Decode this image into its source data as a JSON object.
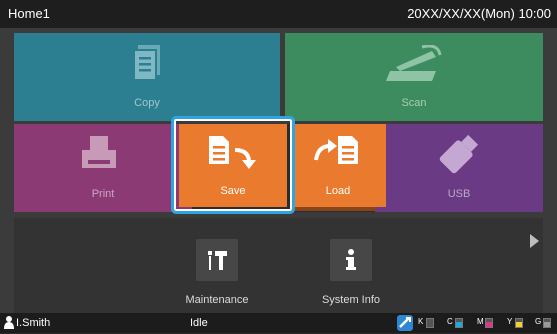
{
  "topbar": {
    "title": "Home1",
    "clock": "20XX/XX/XX(Mon) 10:00"
  },
  "tiles": {
    "copy": "Copy",
    "scan": "Scan",
    "print": "Print",
    "save": "Save",
    "load": "Load",
    "usb": "USB"
  },
  "bottom": {
    "maintenance": "Maintenance",
    "system_info": "System Info"
  },
  "status": {
    "user": "I.Smith",
    "state": "Idle",
    "inks": [
      {
        "label": "K",
        "color": "#222222",
        "level": 0.0
      },
      {
        "label": "C",
        "color": "#1fa7e0",
        "level": 0.6
      },
      {
        "label": "M",
        "color": "#e0338c",
        "level": 0.6
      },
      {
        "label": "Y",
        "color": "#f2d22b",
        "level": 0.6
      },
      {
        "label": "G",
        "color": "#9a9a9a",
        "level": 0.6
      }
    ]
  },
  "colors": {
    "copy_tile": "#2b7f90",
    "scan_tile": "#3d8c5f",
    "print_tile": "#8b3a73",
    "usb_tile": "#6a3a84",
    "save_load_tile": "#ea7a2e",
    "focus": "#2fa4e0"
  }
}
